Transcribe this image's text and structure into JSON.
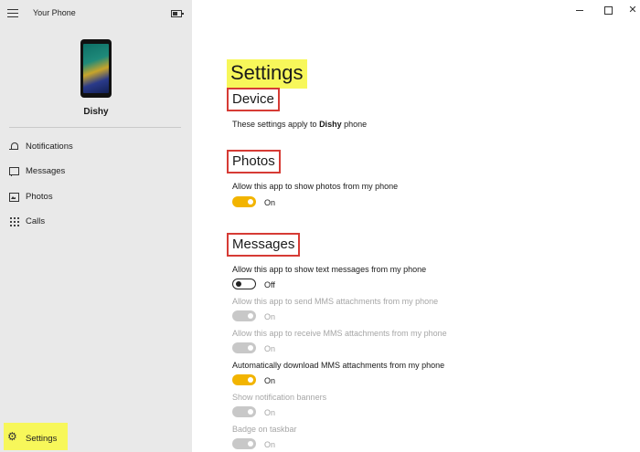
{
  "app": {
    "title": "Your Phone",
    "device_name": "Dishy"
  },
  "nav": {
    "items": [
      {
        "label": "Notifications",
        "icon": "bell-icon"
      },
      {
        "label": "Messages",
        "icon": "message-icon"
      },
      {
        "label": "Photos",
        "icon": "photo-icon"
      },
      {
        "label": "Calls",
        "icon": "dialpad-icon"
      }
    ],
    "settings": {
      "label": "Settings",
      "icon": "gear-icon"
    }
  },
  "settings": {
    "title": "Settings",
    "device": {
      "header": "Device",
      "desc_prefix": "These settings apply to ",
      "device_name": "Dishy",
      "desc_suffix": " phone"
    },
    "photos": {
      "header": "Photos",
      "option": {
        "label": "Allow this app to show photos from my phone",
        "state": "On",
        "enabled": true
      }
    },
    "messages": {
      "header": "Messages",
      "options": [
        {
          "label": "Allow this app to show text messages from my phone",
          "state": "Off",
          "enabled": true
        },
        {
          "label": "Allow this app to send MMS attachments from my phone",
          "state": "On",
          "enabled": false
        },
        {
          "label": "Allow this app to receive MMS attachments from my phone",
          "state": "On",
          "enabled": false
        },
        {
          "label": "Automatically download MMS attachments from my phone",
          "state": "On",
          "enabled": true
        },
        {
          "label": "Show notification banners",
          "state": "On",
          "enabled": false
        },
        {
          "label": "Badge on taskbar",
          "state": "On",
          "enabled": false
        }
      ]
    }
  },
  "colors": {
    "accent": "#f2b400",
    "highlight": "#f7f75a",
    "annotation_box": "#d63b35",
    "sidebar_bg": "#e9e9e9"
  }
}
